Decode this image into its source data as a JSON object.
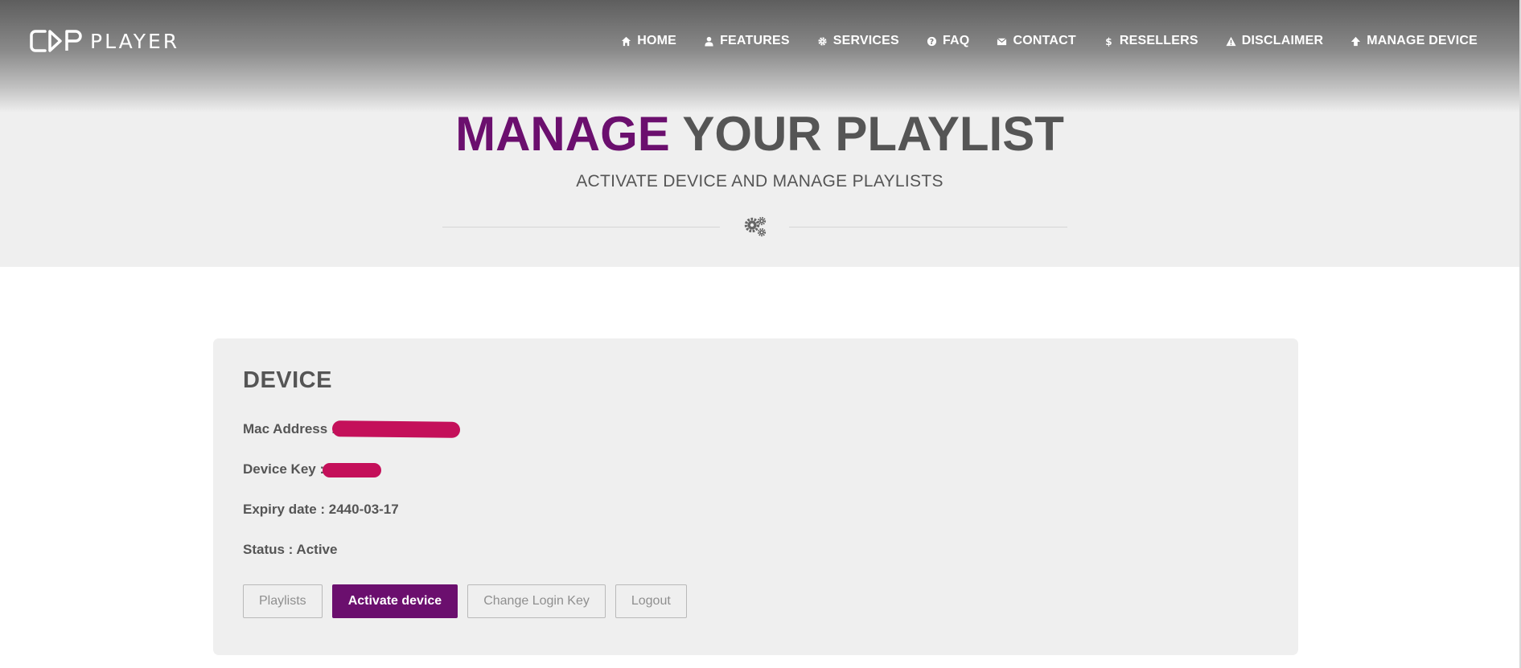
{
  "brand": {
    "logo_text": "PLAYER"
  },
  "nav": {
    "items": [
      {
        "label": "HOME",
        "icon": "home-icon"
      },
      {
        "label": "FEATURES",
        "icon": "user-icon"
      },
      {
        "label": "SERVICES",
        "icon": "gear-icon"
      },
      {
        "label": "FAQ",
        "icon": "question-icon"
      },
      {
        "label": "CONTACT",
        "icon": "envelope-icon"
      },
      {
        "label": "RESELLERS",
        "icon": "dollar-icon"
      },
      {
        "label": "DISCLAIMER",
        "icon": "warning-icon"
      },
      {
        "label": "MANAGE DEVICE",
        "icon": "arrow-up-icon"
      }
    ]
  },
  "hero": {
    "title_accent": "MANAGE",
    "title_rest": "YOUR PLAYLIST",
    "subtitle": "ACTIVATE DEVICE AND MANAGE PLAYLISTS",
    "divider_icon": "gears-icon"
  },
  "device": {
    "title": "DEVICE",
    "mac_label": "Mac Address :",
    "key_label": "Device Key :",
    "expiry": "Expiry date : 2440-03-17",
    "status": "Status : Active"
  },
  "buttons": {
    "playlists": "Playlists",
    "activate": "Activate device",
    "change_key": "Change Login Key",
    "logout": "Logout"
  },
  "colors": {
    "accent": "#6b0f6e",
    "redaction": "#c4105a",
    "text": "#555555"
  }
}
